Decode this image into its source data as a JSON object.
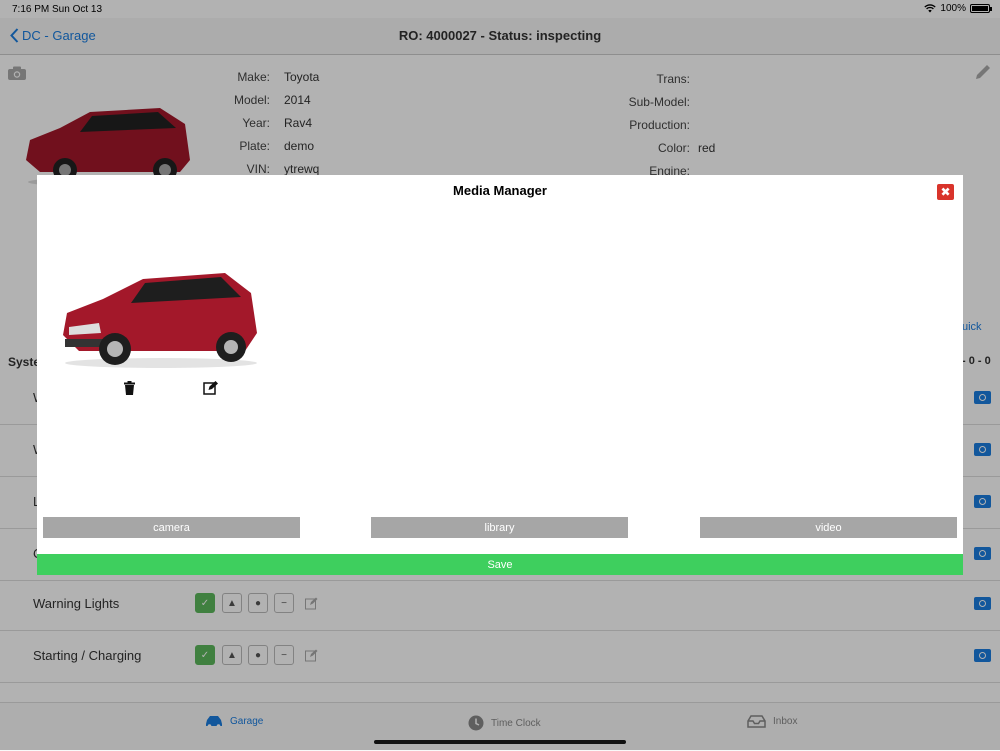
{
  "status_bar": {
    "time": "7:16 PM",
    "date": "Sun Oct 13",
    "battery": "100%"
  },
  "nav": {
    "back_label": "DC - Garage",
    "title": "RO: 4000027 - Status: inspecting"
  },
  "vehicle": {
    "left": [
      {
        "label": "Make:",
        "value": "Toyota"
      },
      {
        "label": "Model:",
        "value": "2014"
      },
      {
        "label": "Year:",
        "value": "Rav4"
      },
      {
        "label": "Plate:",
        "value": "demo"
      },
      {
        "label": "VIN:",
        "value": "ytrewq"
      }
    ],
    "right": [
      {
        "label": "Trans:",
        "value": ""
      },
      {
        "label": "Sub-Model:",
        "value": ""
      },
      {
        "label": "Production:",
        "value": ""
      },
      {
        "label": "Color:",
        "value": "red"
      },
      {
        "label": "Engine:",
        "value": ""
      }
    ]
  },
  "systems": {
    "header_partial": "Syste",
    "quick_partial": "uick",
    "counts_partial": "- 0 - 0",
    "rows": [
      {
        "name": "W"
      },
      {
        "name": "W"
      },
      {
        "name": "L"
      },
      {
        "name": "C"
      },
      {
        "name": "Warning Lights"
      },
      {
        "name": "Starting / Charging"
      }
    ]
  },
  "modal": {
    "title": "Media Manager",
    "close_glyph": "✖",
    "buttons": {
      "camera": "camera",
      "library": "library",
      "video": "video"
    },
    "save": "Save"
  },
  "tabs": [
    {
      "label": "Garage",
      "icon": "car-icon",
      "active": true
    },
    {
      "label": "Time Clock",
      "icon": "clock-icon",
      "active": false
    },
    {
      "label": "Inbox",
      "icon": "inbox-icon",
      "active": false
    }
  ],
  "colors": {
    "accent": "#1a7de0",
    "save_green": "#3ecf5e",
    "close_red": "#d9342b",
    "media_button_gray": "#a6a6a6",
    "car_red": "#a3182a"
  }
}
